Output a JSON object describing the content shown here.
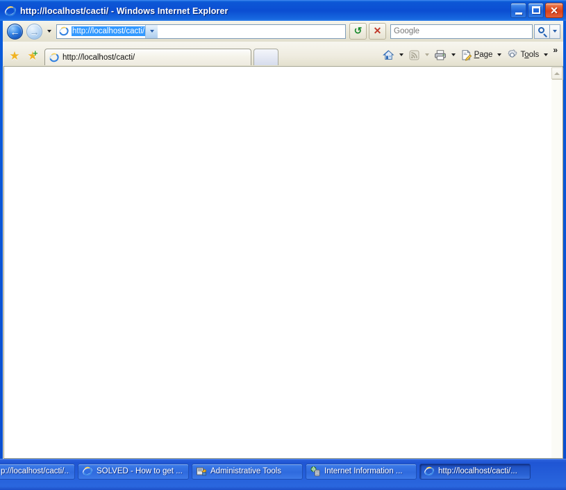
{
  "window": {
    "title": "http://localhost/cacti/ - Windows Internet Explorer",
    "icon": "internet-explorer-icon",
    "controls": {
      "minimize": "Minimize",
      "maximize": "Maximize",
      "close": "Close"
    }
  },
  "navbar": {
    "back": {
      "label": "Back",
      "enabled": true,
      "icon": "back-arrow-icon"
    },
    "forward": {
      "label": "Forward",
      "enabled": false,
      "icon": "forward-arrow-icon"
    },
    "recent_pages": {
      "label": "Recent Pages",
      "icon": "chevron-down-icon"
    },
    "address": {
      "icon": "page-icon",
      "value": "http://localhost/cacti/",
      "selected": true,
      "dropdown_icon": "chevron-down-icon"
    },
    "refresh": {
      "label": "Refresh",
      "icon": "refresh-icon",
      "glyph": "↻"
    },
    "stop": {
      "label": "Stop",
      "icon": "stop-icon",
      "glyph": "✕"
    },
    "search": {
      "placeholder": "Google",
      "value": "",
      "go_icon": "search-icon",
      "dropdown_icon": "chevron-down-icon"
    }
  },
  "tabbar": {
    "favorites_center": {
      "label": "Favorites Center",
      "icon": "star-icon"
    },
    "add_to_favorites": {
      "label": "Add to Favorites",
      "icon": "star-plus-icon"
    },
    "tabs": [
      {
        "label": "http://localhost/cacti/",
        "icon": "internet-explorer-icon",
        "active": true
      }
    ],
    "new_tab": {
      "label": "",
      "tooltip": "New Tab"
    }
  },
  "commandbar": {
    "items": [
      {
        "name": "home",
        "label": "",
        "icon": "home-icon",
        "enabled": true,
        "has_dropdown": true
      },
      {
        "name": "feeds",
        "label": "",
        "icon": "rss-feed-icon",
        "enabled": false,
        "has_dropdown": true
      },
      {
        "name": "print",
        "label": "",
        "icon": "printer-icon",
        "enabled": true,
        "has_dropdown": true
      },
      {
        "name": "page",
        "label": "Page",
        "accel": "P",
        "icon": "page-edit-icon",
        "enabled": true,
        "has_dropdown": true
      },
      {
        "name": "tools",
        "label": "Tools",
        "accel": "o",
        "icon": "gear-icon",
        "enabled": true,
        "has_dropdown": true
      }
    ],
    "overflow": {
      "label": "»",
      "name": "more-commands"
    }
  },
  "viewport": {
    "content": "",
    "scrollbar": {
      "up_arrow": "scroll-up-icon",
      "enabled": false
    }
  },
  "taskbar": {
    "buttons": [
      {
        "label": "p://localhost/cacti/...",
        "icon": "none",
        "pressed": false,
        "clipped": true,
        "width": 118
      },
      {
        "label": "SOLVED - How to get ...",
        "icon": "internet-explorer-icon",
        "pressed": false,
        "width": 160
      },
      {
        "label": "Administrative Tools",
        "icon": "admin-tools-icon",
        "pressed": false,
        "width": 160
      },
      {
        "label": "Internet Information ...",
        "icon": "iis-icon",
        "pressed": false,
        "width": 160
      },
      {
        "label": "http://localhost/cacti/...",
        "icon": "internet-explorer-icon",
        "pressed": true,
        "width": 160
      }
    ]
  },
  "colors": {
    "title_blue": "#0b4ed2",
    "taskbar_blue": "#2a62d4",
    "selection_blue": "#3399ff",
    "chrome_beige": "#ece9d8",
    "page_white": "#ffffff",
    "close_red": "#d9411a",
    "star_gold": "#f0b323",
    "plus_green": "#3aa534"
  }
}
